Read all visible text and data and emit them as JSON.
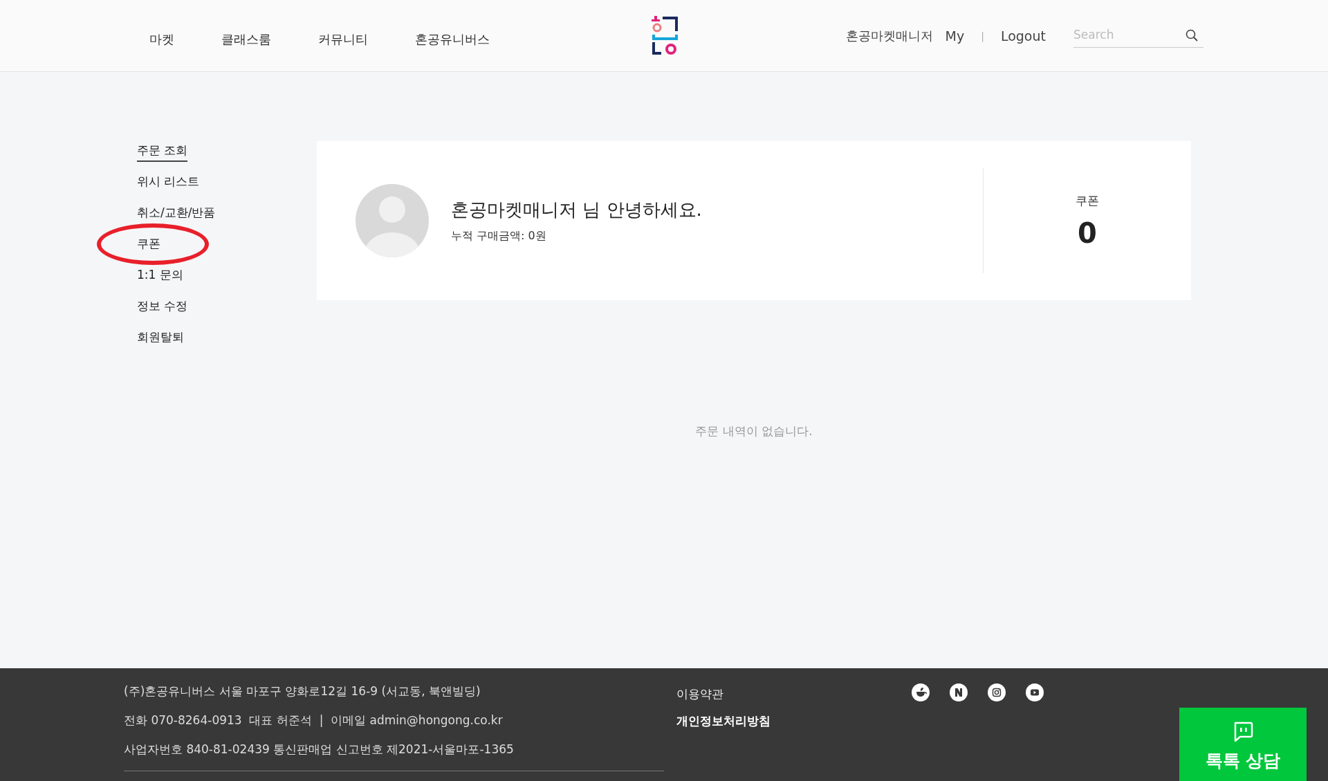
{
  "header": {
    "nav": [
      {
        "label": "마켓"
      },
      {
        "label": "클래스룸"
      },
      {
        "label": "커뮤니티"
      },
      {
        "label": "혼공유니버스"
      }
    ],
    "user": "혼공마켓매니저",
    "my": "My",
    "separator": "|",
    "logout": "Logout",
    "search": {
      "placeholder": "Search"
    }
  },
  "sidebar": {
    "items": [
      {
        "label": "주문 조회",
        "selected": true,
        "circled": false
      },
      {
        "label": "위시 리스트",
        "selected": false,
        "circled": false
      },
      {
        "label": "취소/교환/반품",
        "selected": false,
        "circled": false
      },
      {
        "label": "쿠폰",
        "selected": false,
        "circled": true
      },
      {
        "label": "1:1 문의",
        "selected": false,
        "circled": false
      },
      {
        "label": "정보 수정",
        "selected": false,
        "circled": false
      },
      {
        "label": "회원탈퇴",
        "selected": false,
        "circled": false
      }
    ]
  },
  "profile": {
    "greeting": "혼공마켓매니저 님 안녕하세요.",
    "total": "누적 구매금액: 0원",
    "coupon_label": "쿠폰",
    "coupon_count": "0"
  },
  "empty_message": "주문 내역이 없습니다.",
  "footer": {
    "lines": [
      "(주)혼공유니버스 서울 마포구 양화로12길 16-9 (서교동, 북앤빌딩)",
      "전화 070-8264-0913  대표 허준석  |  이메일 admin@hongong.co.kr",
      "사업자번호 840-81-02439 통신판매업 신고번호 제2021-서울마포-1365"
    ],
    "links": [
      {
        "label": "이용약관",
        "bold": false
      },
      {
        "label": "개인정보처리방침",
        "bold": true
      }
    ],
    "social": [
      {
        "kind": "cafe"
      },
      {
        "kind": "naver"
      },
      {
        "kind": "instagram"
      },
      {
        "kind": "youtube"
      }
    ]
  },
  "chat_button": {
    "label": "톡톡 상담"
  }
}
